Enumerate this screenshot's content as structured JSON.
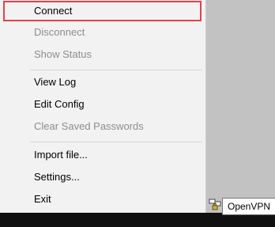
{
  "menu": {
    "items": [
      {
        "label": "Connect"
      },
      {
        "label": "Disconnect"
      },
      {
        "label": "Show Status"
      },
      {
        "label": "View Log"
      },
      {
        "label": "Edit Config"
      },
      {
        "label": "Clear Saved Passwords"
      },
      {
        "label": "Import file..."
      },
      {
        "label": "Settings..."
      },
      {
        "label": "Exit"
      }
    ]
  },
  "tray": {
    "tooltip": "OpenVPN",
    "icon": "network-lock-icon"
  },
  "colors": {
    "highlight_border": "#e0434b",
    "disabled_text": "#8d8d8d",
    "menu_bg": "#f2f2f2"
  }
}
